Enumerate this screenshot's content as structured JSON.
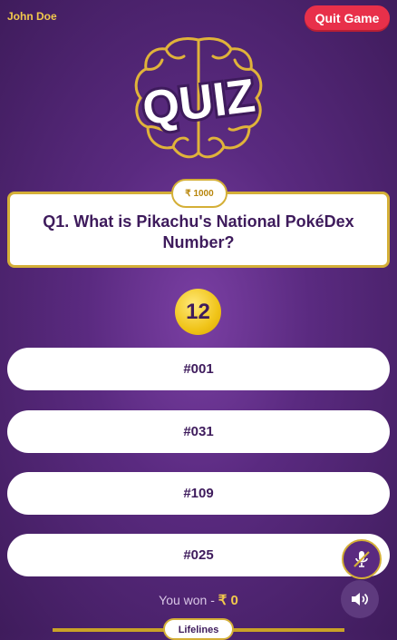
{
  "header": {
    "username": "John Doe",
    "quit_label": "Quit Game"
  },
  "logo": {
    "text": "QUIZ"
  },
  "question": {
    "prize": "₹ 1000",
    "text": "Q1. What is Pikachu's National PokéDex Number?"
  },
  "timer": {
    "value": "12"
  },
  "options": [
    "#001",
    "#031",
    "#109",
    "#025"
  ],
  "controls": {
    "mic_icon": "mic-muted-icon",
    "volume_icon": "speaker-icon"
  },
  "footer": {
    "won_label": "You won - ",
    "won_amount": "₹ 0",
    "lifelines_label": "Lifelines"
  },
  "colors": {
    "accent_gold": "#d4af37",
    "quit_red": "#e8304a",
    "text_purple": "#3e1b5c"
  }
}
